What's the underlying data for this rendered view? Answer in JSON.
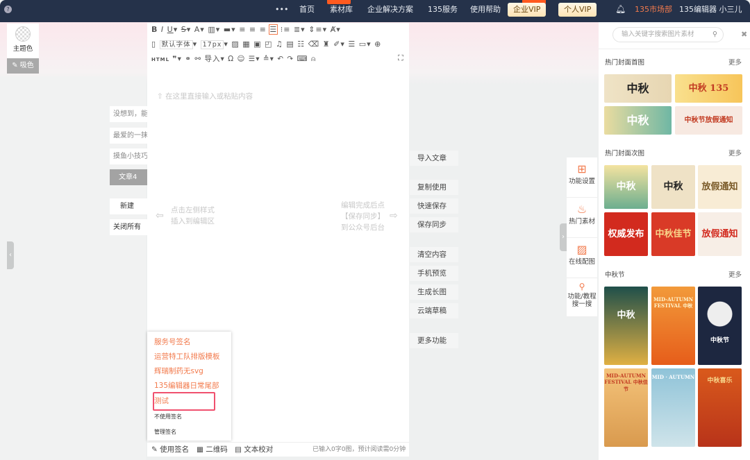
{
  "topbar": {
    "more": "•••",
    "nav": [
      "首页",
      "素材库",
      "企业解决方案",
      "135服务",
      "使用帮助"
    ],
    "enterprise_vip": "企业VIP",
    "personal_vip": "个人VIP",
    "team": "135市场部",
    "user": "135编辑器 小三儿"
  },
  "left": {
    "theme_color": "主题色",
    "eyedropper": "吸色",
    "articles": [
      "没想到，能",
      "最爱的一抹",
      "摸鱼小技巧",
      "文章4"
    ],
    "new": "新建",
    "close_all": "关闭所有"
  },
  "editor": {
    "font": "默认字体",
    "size": "17px",
    "html": "HTML",
    "import": "导入",
    "placeholder": "在这里直接输入或粘贴内容",
    "hint_left": [
      "点击左侧样式",
      "插入到编辑区"
    ],
    "hint_right": [
      "编辑完成后点",
      "【保存同步】",
      "到公众号后台"
    ]
  },
  "signature_menu": {
    "items": [
      "服务号签名",
      "运营特工队排版模板",
      "辉瑞制药无svg",
      "135编辑器日常尾部",
      "测试"
    ],
    "no_signature": "不使用签名",
    "manage": "管理签名"
  },
  "bottom": {
    "signature": "使用签名",
    "qrcode": "二维码",
    "proofread": "文本校对",
    "status": "已输入0字0图，预计阅读需0分钟"
  },
  "actions": [
    "导入文章",
    "复制使用",
    "快速保存",
    "保存同步",
    "清空内容",
    "手机预览",
    "生成长图",
    "云端草稿",
    "更多功能"
  ],
  "side_tabs": [
    "功能设置",
    "热门素材",
    "在线配图",
    "功能/教程\n搜一搜"
  ],
  "right": {
    "search_placeholder": "输入关键字搜索图片素材",
    "more": "更多",
    "sections": [
      {
        "title": "热门封面首图",
        "thumbs": [
          "中秋",
          "中秋 135",
          "中秋",
          "中秋节放假通知"
        ]
      },
      {
        "title": "热门封面次图",
        "thumbs": [
          "中秋",
          "中秋",
          "放假通知",
          "权威发布",
          "中秋佳节",
          "放假通知"
        ]
      },
      {
        "title": "中秋节",
        "thumbs": [
          "中秋",
          "MID-AUTUMN FESTIVAL 中秋",
          "中秋节",
          "MID-AUTUMN FESTIVAL 中秋佳节",
          "MID · AUTUMN",
          "中秋喜乐"
        ]
      }
    ]
  },
  "colors": {
    "topbar": "#25324a",
    "accent": "#f27a4c",
    "highlight": "#f0506e"
  }
}
